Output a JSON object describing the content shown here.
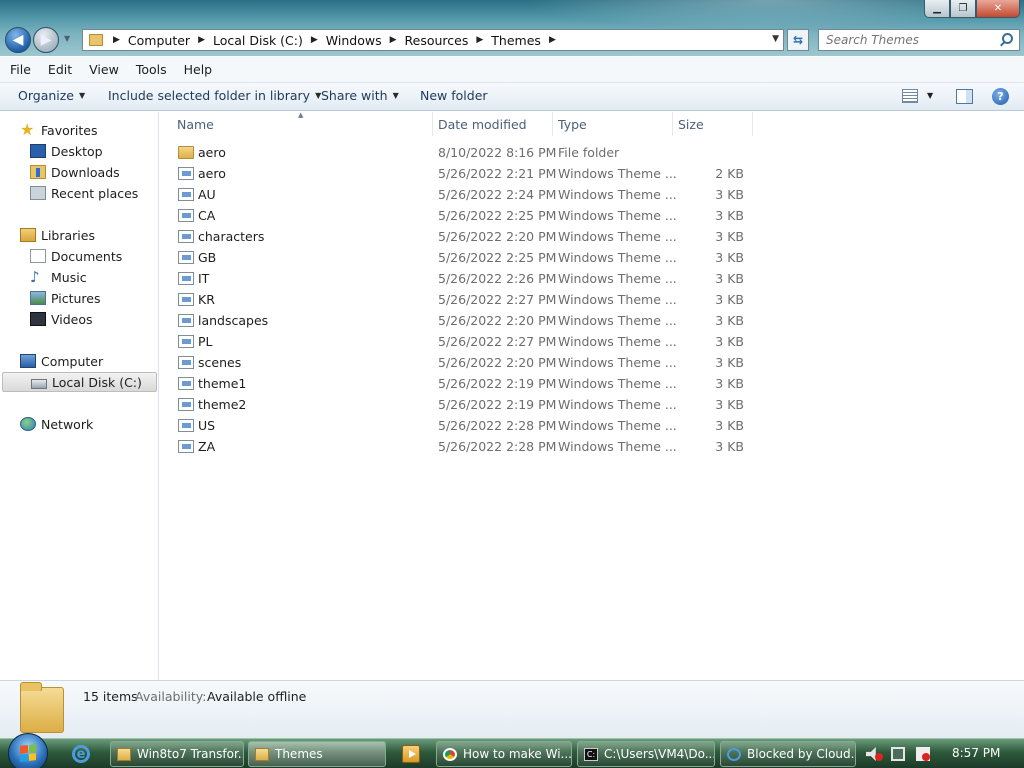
{
  "window": {
    "buttons": [
      "minimize",
      "maximize",
      "close"
    ]
  },
  "address": {
    "crumbs": [
      "Computer",
      "Local Disk (C:)",
      "Windows",
      "Resources",
      "Themes"
    ]
  },
  "search": {
    "placeholder": "Search Themes"
  },
  "menu": [
    "File",
    "Edit",
    "View",
    "Tools",
    "Help"
  ],
  "commands": {
    "organize": "Organize",
    "include": "Include selected folder in library",
    "share": "Share with",
    "new_folder": "New folder"
  },
  "nav": {
    "favorites": "Favorites",
    "desktop": "Desktop",
    "downloads": "Downloads",
    "recent": "Recent places",
    "libraries": "Libraries",
    "documents": "Documents",
    "music": "Music",
    "pictures": "Pictures",
    "videos": "Videos",
    "computer": "Computer",
    "local_disk": "Local Disk (C:)",
    "network": "Network"
  },
  "columns": {
    "name": "Name",
    "date": "Date modified",
    "type": "Type",
    "size": "Size"
  },
  "files": [
    {
      "name": "aero",
      "date": "8/10/2022 8:16 PM",
      "type": "File folder",
      "size": "",
      "kind": "folder"
    },
    {
      "name": "aero",
      "date": "5/26/2022 2:21 PM",
      "type": "Windows Theme ...",
      "size": "2 KB",
      "kind": "theme"
    },
    {
      "name": "AU",
      "date": "5/26/2022 2:24 PM",
      "type": "Windows Theme ...",
      "size": "3 KB",
      "kind": "theme"
    },
    {
      "name": "CA",
      "date": "5/26/2022 2:25 PM",
      "type": "Windows Theme ...",
      "size": "3 KB",
      "kind": "theme"
    },
    {
      "name": "characters",
      "date": "5/26/2022 2:20 PM",
      "type": "Windows Theme ...",
      "size": "3 KB",
      "kind": "theme"
    },
    {
      "name": "GB",
      "date": "5/26/2022 2:25 PM",
      "type": "Windows Theme ...",
      "size": "3 KB",
      "kind": "theme"
    },
    {
      "name": "IT",
      "date": "5/26/2022 2:26 PM",
      "type": "Windows Theme ...",
      "size": "3 KB",
      "kind": "theme"
    },
    {
      "name": "KR",
      "date": "5/26/2022 2:27 PM",
      "type": "Windows Theme ...",
      "size": "3 KB",
      "kind": "theme"
    },
    {
      "name": "landscapes",
      "date": "5/26/2022 2:20 PM",
      "type": "Windows Theme ...",
      "size": "3 KB",
      "kind": "theme"
    },
    {
      "name": "PL",
      "date": "5/26/2022 2:27 PM",
      "type": "Windows Theme ...",
      "size": "3 KB",
      "kind": "theme"
    },
    {
      "name": "scenes",
      "date": "5/26/2022 2:20 PM",
      "type": "Windows Theme ...",
      "size": "3 KB",
      "kind": "theme"
    },
    {
      "name": "theme1",
      "date": "5/26/2022 2:19 PM",
      "type": "Windows Theme ...",
      "size": "3 KB",
      "kind": "theme"
    },
    {
      "name": "theme2",
      "date": "5/26/2022 2:19 PM",
      "type": "Windows Theme ...",
      "size": "3 KB",
      "kind": "theme"
    },
    {
      "name": "US",
      "date": "5/26/2022 2:28 PM",
      "type": "Windows Theme ...",
      "size": "3 KB",
      "kind": "theme"
    },
    {
      "name": "ZA",
      "date": "5/26/2022 2:28 PM",
      "type": "Windows Theme ...",
      "size": "3 KB",
      "kind": "theme"
    }
  ],
  "details": {
    "count": "15 items",
    "availability_label": "Availability:",
    "availability_value": "Available offline"
  },
  "taskbar": {
    "tasks": [
      {
        "label": "Win8to7 Transfor...",
        "icon": "folder-icon"
      },
      {
        "label": "Themes",
        "icon": "folder-icon"
      },
      {
        "label": "How to make Wi...",
        "icon": "chrome-icon"
      },
      {
        "label": "C:\\Users\\VM4\\Do...",
        "icon": "cmd-icon"
      },
      {
        "label": "Blocked by Cloud...",
        "icon": "ie-icon"
      }
    ],
    "clock": "8:57 PM"
  }
}
